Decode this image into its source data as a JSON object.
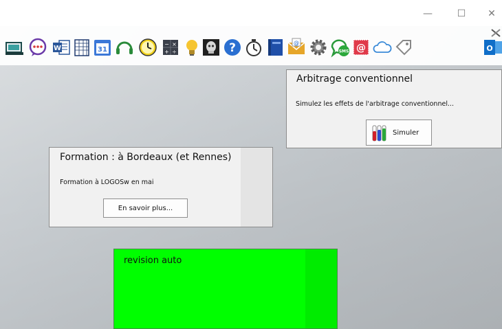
{
  "window": {
    "minimize_label": "—",
    "maximize_label": "☐",
    "close_label": "✕"
  },
  "toolbar": {
    "tools": [
      "scanner-icon",
      "chat-bubble-icon",
      "word-icon",
      "grid-sheet-icon",
      "google-calendar-icon",
      "headset-icon",
      "clock-icon",
      "calculator-icon",
      "lightbulb-icon",
      "xray-skull-icon",
      "help-icon",
      "timer-icon",
      "notebook-icon",
      "email-envelope-icon",
      "settings-gear-icon",
      "sms-icon",
      "mail-stamp-icon",
      "cloud-icon",
      "tag-icon",
      "outlook-icon"
    ]
  },
  "arbitrage": {
    "title": "Arbitrage conventionnel",
    "description": "Simulez les effets de l'arbitrage conventionnel...",
    "button_label": "Simuler"
  },
  "formation": {
    "title": "Formation : à Bordeaux (et Rennes)",
    "description": "Formation à LOGOSw en mai",
    "button_label": "En savoir plus..."
  },
  "revision": {
    "label": "revision auto",
    "color": "#00ff00"
  }
}
